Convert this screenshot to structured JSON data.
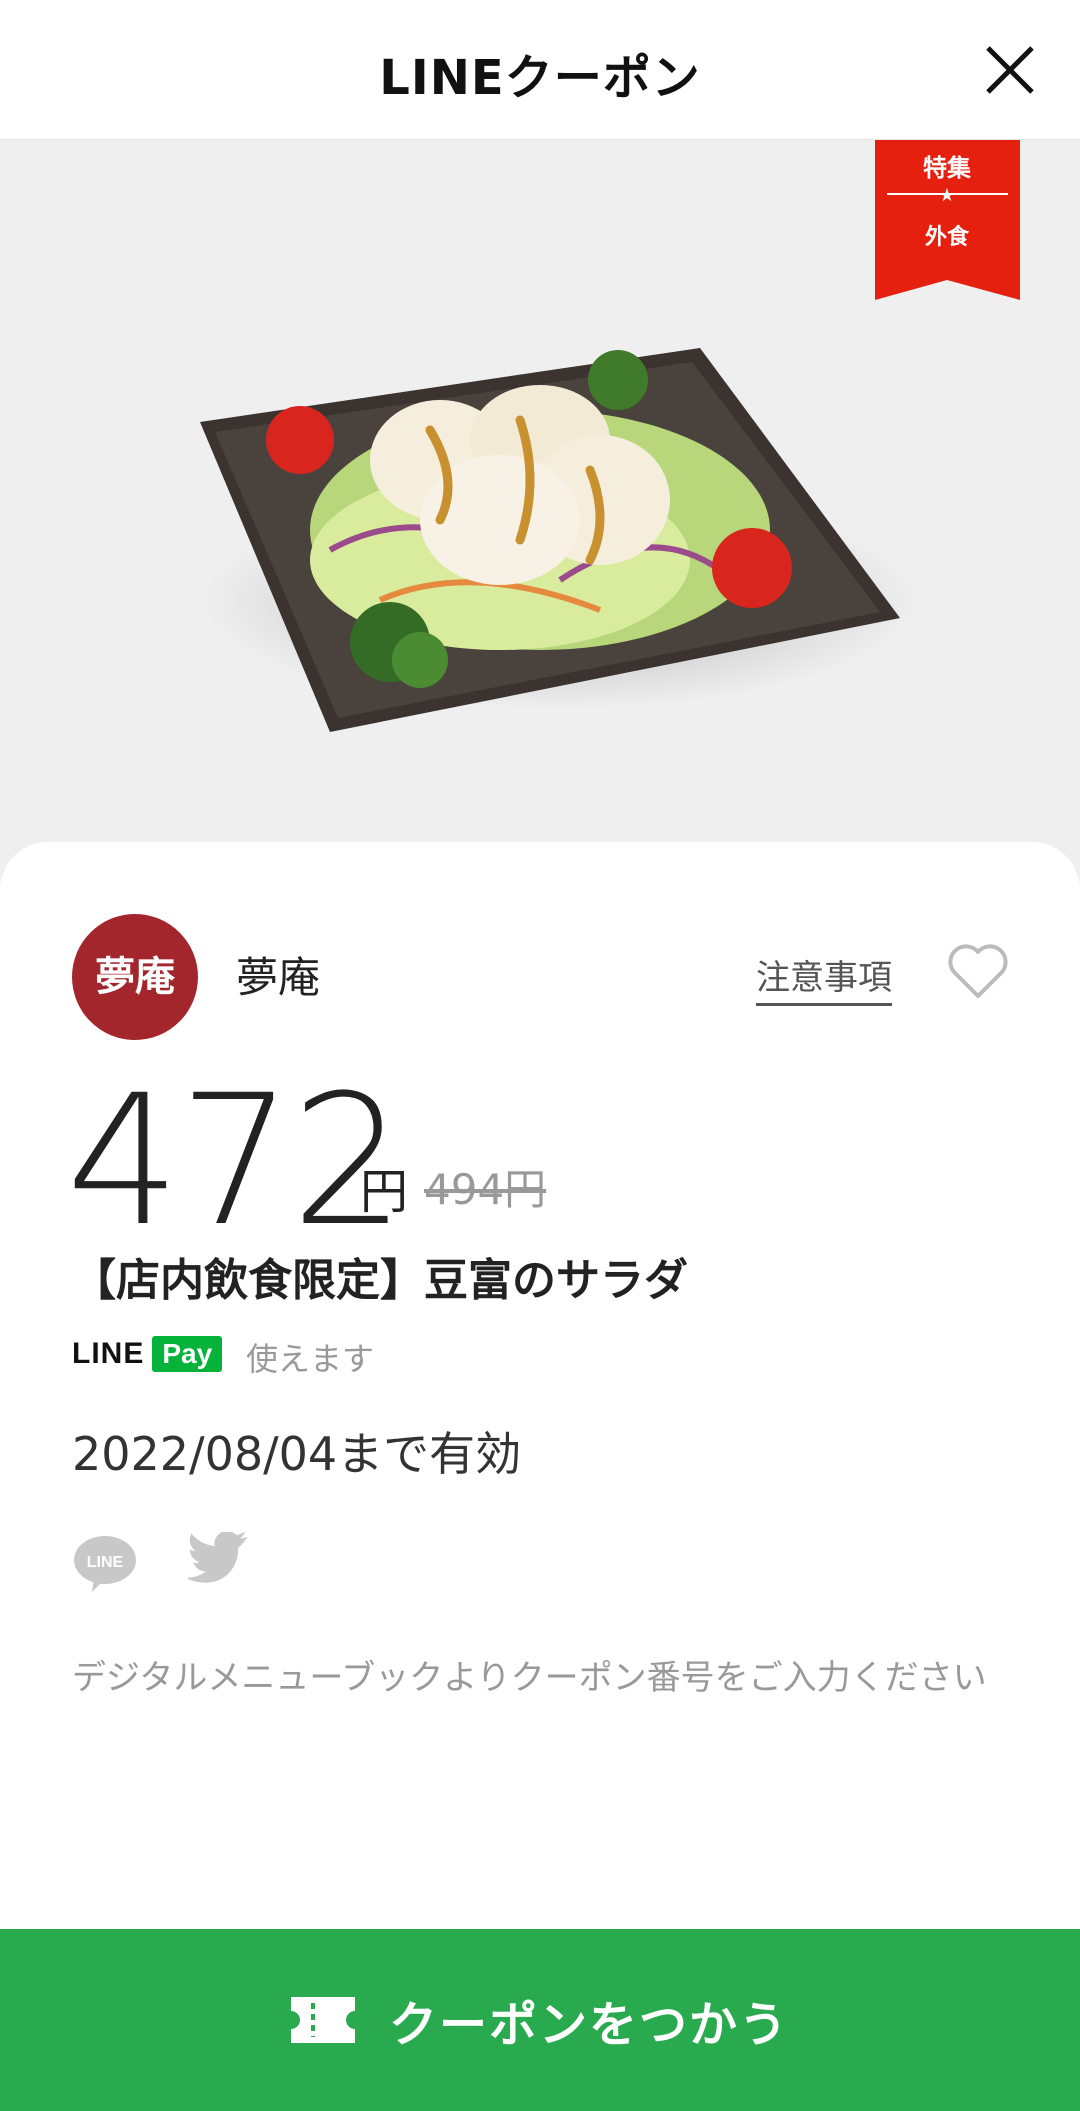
{
  "header": {
    "title": "LINEクーポン",
    "close_icon": "close-icon"
  },
  "hero": {
    "image": "tofu-salad-photo",
    "badge": {
      "line1": "特集",
      "line2": "外食",
      "color": "#e6200f"
    }
  },
  "store": {
    "logo_text": "夢庵",
    "name": "夢庵",
    "notes_label": "注意事項",
    "favorite_icon": "heart-icon",
    "logo_color": "#a3262d"
  },
  "offer": {
    "price": "472",
    "currency": "円",
    "original_price": "494円",
    "title": "【店内飲食限定】豆富のサラダ",
    "linepay": {
      "line": "LINE",
      "pay": "Pay",
      "usable": "使えます"
    },
    "expiry": "2022/08/04まで有効",
    "note": "デジタルメニューブックよりクーポン番号をご入力ください"
  },
  "share": {
    "line_icon": "line-share-icon",
    "line_icon_text": "LINE",
    "twitter_icon": "twitter-icon"
  },
  "cta": {
    "label": "クーポンをつかう",
    "color": "#2aaa4f"
  }
}
